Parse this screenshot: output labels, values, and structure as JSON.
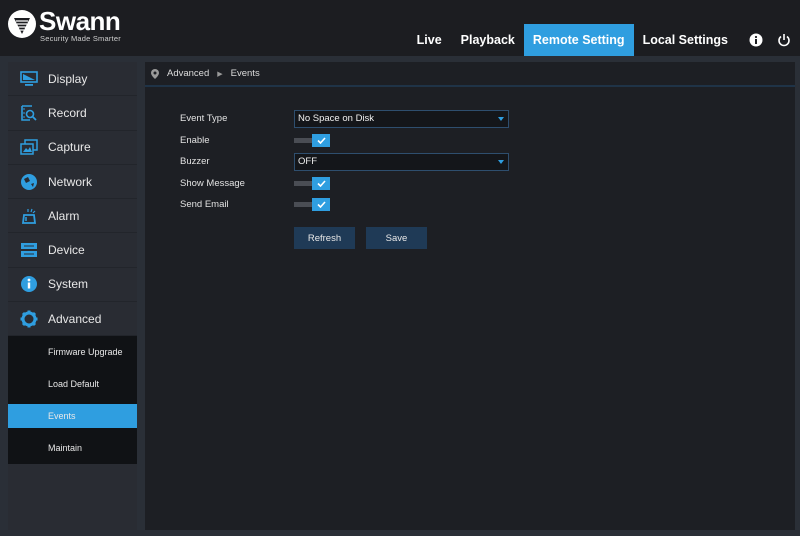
{
  "brand": {
    "name": "Swann",
    "tagline": "Security Made Smarter"
  },
  "nav": {
    "items": [
      {
        "label": "Live",
        "active": false
      },
      {
        "label": "Playback",
        "active": false
      },
      {
        "label": "Remote Setting",
        "active": true
      },
      {
        "label": "Local Settings",
        "active": false
      }
    ],
    "icons": [
      "info-icon",
      "power-icon"
    ]
  },
  "sidebar": {
    "items": [
      {
        "label": "Display",
        "icon": "monitor-icon"
      },
      {
        "label": "Record",
        "icon": "record-search-icon"
      },
      {
        "label": "Capture",
        "icon": "capture-icon"
      },
      {
        "label": "Network",
        "icon": "network-globe-icon"
      },
      {
        "label": "Alarm",
        "icon": "alarm-siren-icon"
      },
      {
        "label": "Device",
        "icon": "device-storage-icon"
      },
      {
        "label": "System",
        "icon": "info-circle-icon"
      },
      {
        "label": "Advanced",
        "icon": "gear-icon"
      }
    ],
    "submenu": [
      {
        "label": "Firmware Upgrade",
        "active": false
      },
      {
        "label": "Load Default",
        "active": false
      },
      {
        "label": "Events",
        "active": true
      },
      {
        "label": "Maintain",
        "active": false
      }
    ]
  },
  "breadcrumb": {
    "items": [
      "Advanced",
      "Events"
    ]
  },
  "form": {
    "event_type": {
      "label": "Event Type",
      "value": "No Space on Disk"
    },
    "enable": {
      "label": "Enable",
      "checked": true
    },
    "buzzer": {
      "label": "Buzzer",
      "value": "OFF"
    },
    "show_message": {
      "label": "Show Message",
      "checked": true
    },
    "send_email": {
      "label": "Send Email",
      "checked": true
    }
  },
  "buttons": {
    "refresh": "Refresh",
    "save": "Save"
  },
  "colors": {
    "accent": "#2f9ee0",
    "button": "#1f3a56",
    "header_bg": "#1c1d21",
    "panel_bg": "#1d1f24"
  }
}
